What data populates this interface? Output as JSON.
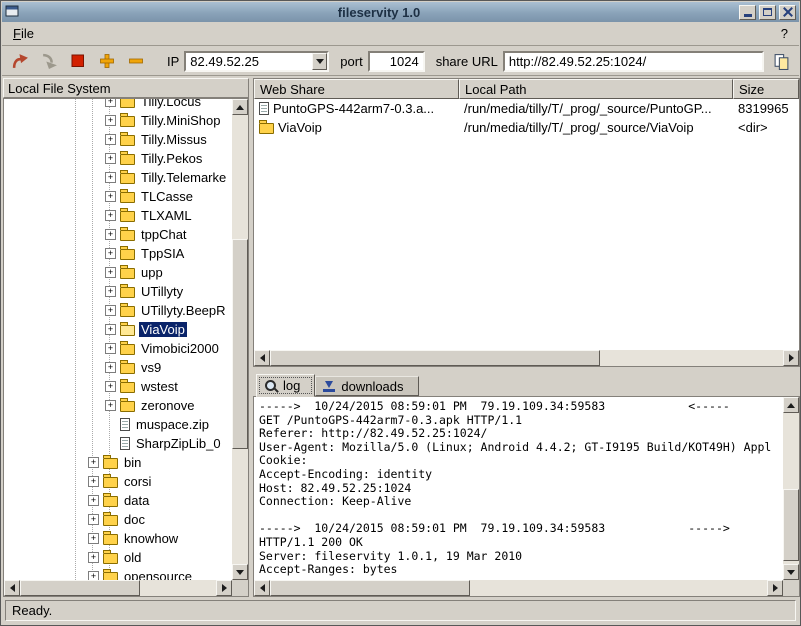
{
  "window": {
    "title": "fileservity 1.0"
  },
  "menu": {
    "items": [
      {
        "label": "File"
      },
      {
        "label": "?"
      }
    ]
  },
  "toolbar": {
    "ip": {
      "label": "IP",
      "value": "82.49.52.25"
    },
    "port": {
      "label": "port",
      "value": "1024"
    },
    "share_url": {
      "label": "share URL",
      "value": "http://82.49.52.25:1024/"
    },
    "buttons": [
      "open-url",
      "forward",
      "stop-server",
      "add-share",
      "remove-share",
      "copy-url"
    ]
  },
  "file_panel": {
    "header": "Local File System",
    "items": [
      {
        "label": "Tilly.Locus",
        "level": 2,
        "icon": "folder",
        "expander": true,
        "clipped_top": true
      },
      {
        "label": "Tilly.MiniShop",
        "level": 2,
        "icon": "folder",
        "expander": true
      },
      {
        "label": "Tilly.Missus",
        "level": 2,
        "icon": "folder",
        "expander": true
      },
      {
        "label": "Tilly.Pekos",
        "level": 2,
        "icon": "folder",
        "expander": true
      },
      {
        "label": "Tilly.Telemarke",
        "level": 2,
        "icon": "folder",
        "expander": true
      },
      {
        "label": "TLCasse",
        "level": 2,
        "icon": "folder",
        "expander": true
      },
      {
        "label": "TLXAML",
        "level": 2,
        "icon": "folder",
        "expander": true
      },
      {
        "label": "tppChat",
        "level": 2,
        "icon": "folder",
        "expander": true
      },
      {
        "label": "TppSIA",
        "level": 2,
        "icon": "folder",
        "expander": true
      },
      {
        "label": "upp",
        "level": 2,
        "icon": "folder",
        "expander": true
      },
      {
        "label": "UTillyty",
        "level": 2,
        "icon": "folder",
        "expander": true
      },
      {
        "label": "UTillyty.BeepR",
        "level": 2,
        "icon": "folder",
        "expander": true
      },
      {
        "label": "ViaVoip",
        "level": 2,
        "icon": "folder-open",
        "expander": true,
        "selected": true
      },
      {
        "label": "Vimobici2000",
        "level": 2,
        "icon": "folder",
        "expander": true
      },
      {
        "label": "vs9",
        "level": 2,
        "icon": "folder",
        "expander": true
      },
      {
        "label": "wstest",
        "level": 2,
        "icon": "folder",
        "expander": true
      },
      {
        "label": "zeronove",
        "level": 2,
        "icon": "folder",
        "expander": true
      },
      {
        "label": "muspace.zip",
        "level": 2,
        "icon": "file",
        "expander": false
      },
      {
        "label": "SharpZipLib_0",
        "level": 2,
        "icon": "file",
        "expander": false
      },
      {
        "label": "bin",
        "level": 1,
        "icon": "folder",
        "expander": true
      },
      {
        "label": "corsi",
        "level": 1,
        "icon": "folder",
        "expander": true
      },
      {
        "label": "data",
        "level": 1,
        "icon": "folder",
        "expander": true
      },
      {
        "label": "doc",
        "level": 1,
        "icon": "folder",
        "expander": true
      },
      {
        "label": "knowhow",
        "level": 1,
        "icon": "folder",
        "expander": true
      },
      {
        "label": "old",
        "level": 1,
        "icon": "folder",
        "expander": true
      },
      {
        "label": "opensource",
        "level": 1,
        "icon": "folder",
        "expander": true
      }
    ]
  },
  "share_table": {
    "columns": [
      {
        "label": "Web Share"
      },
      {
        "label": "Local Path"
      },
      {
        "label": "Size"
      }
    ],
    "rows": [
      {
        "icon": "file",
        "web_share": "PuntoGPS-442arm7-0.3.a...",
        "local_path": "/run/media/tilly/T/_prog/_source/PuntoGP...",
        "size": "8319965"
      },
      {
        "icon": "folder",
        "web_share": "ViaVoip",
        "local_path": "/run/media/tilly/T/_prog/_source/ViaVoip",
        "size": "<dir>"
      }
    ]
  },
  "tabs": [
    {
      "label": "log",
      "icon": "magnifier",
      "active": true
    },
    {
      "label": "downloads",
      "icon": "download",
      "active": false
    }
  ],
  "log": {
    "lines": [
      "----->  10/24/2015 08:59:01 PM  79.19.109.34:59583            <-----",
      "GET /PuntoGPS-442arm7-0.3.apk HTTP/1.1",
      "Referer: http://82.49.52.25:1024/",
      "User-Agent: Mozilla/5.0 (Linux; Android 4.4.2; GT-I9195 Build/KOT49H) Appl",
      "Cookie:",
      "Accept-Encoding: identity",
      "Host: 82.49.52.25:1024",
      "Connection: Keep-Alive",
      "",
      "----->  10/24/2015 08:59:01 PM  79.19.109.34:59583            ----->",
      "HTTP/1.1 200 OK",
      "Server: fileservity 1.0.1, 19 Mar 2010",
      "Accept-Ranges: bytes"
    ]
  },
  "statusbar": {
    "text": "Ready."
  },
  "colors": {
    "selection": "#0a246a",
    "titlebar": "#8aa3b9",
    "folder": "#ffd24a",
    "stop_red": "#d22000",
    "plus_gold": "#f0a50a"
  }
}
